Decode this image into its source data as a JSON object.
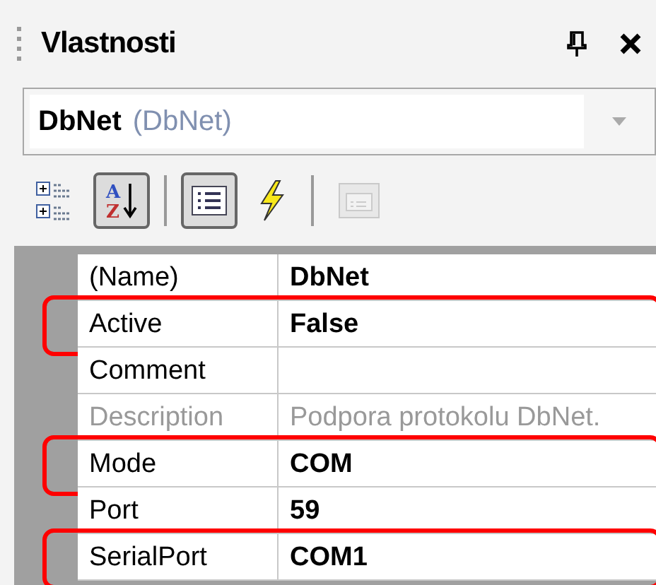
{
  "panel": {
    "title": "Vlastnosti"
  },
  "object_selector": {
    "name": "DbNet",
    "type": "(DbNet)"
  },
  "toolbar": [
    {
      "kind": "categorized",
      "selected": false,
      "disabled": false
    },
    {
      "kind": "alphabetical",
      "selected": true,
      "disabled": false,
      "letters": [
        "A",
        "Z"
      ]
    },
    {
      "kind": "separator"
    },
    {
      "kind": "properties",
      "selected": true,
      "disabled": false
    },
    {
      "kind": "events",
      "selected": false,
      "disabled": false
    },
    {
      "kind": "separator"
    },
    {
      "kind": "property-pages",
      "selected": false,
      "disabled": true
    }
  ],
  "properties": [
    {
      "name": "(Name)",
      "value": "DbNet",
      "modified": true,
      "disabled": false,
      "highlighted": false
    },
    {
      "name": "Active",
      "value": "False",
      "modified": true,
      "disabled": false,
      "highlighted": true
    },
    {
      "name": "Comment",
      "disabled": false,
      "highlighted": false
    },
    {
      "name": "Description",
      "value": "Podpora protokolu DbNet.",
      "modified": false,
      "disabled": true,
      "highlighted": false
    },
    {
      "name": "Mode",
      "value": "COM",
      "modified": true,
      "disabled": false,
      "highlighted": true
    },
    {
      "name": "Port",
      "value": "59",
      "modified": true,
      "disabled": false,
      "highlighted": false
    },
    {
      "name": "SerialPort",
      "value": "COM1",
      "modified": true,
      "disabled": false,
      "highlighted": true
    }
  ]
}
